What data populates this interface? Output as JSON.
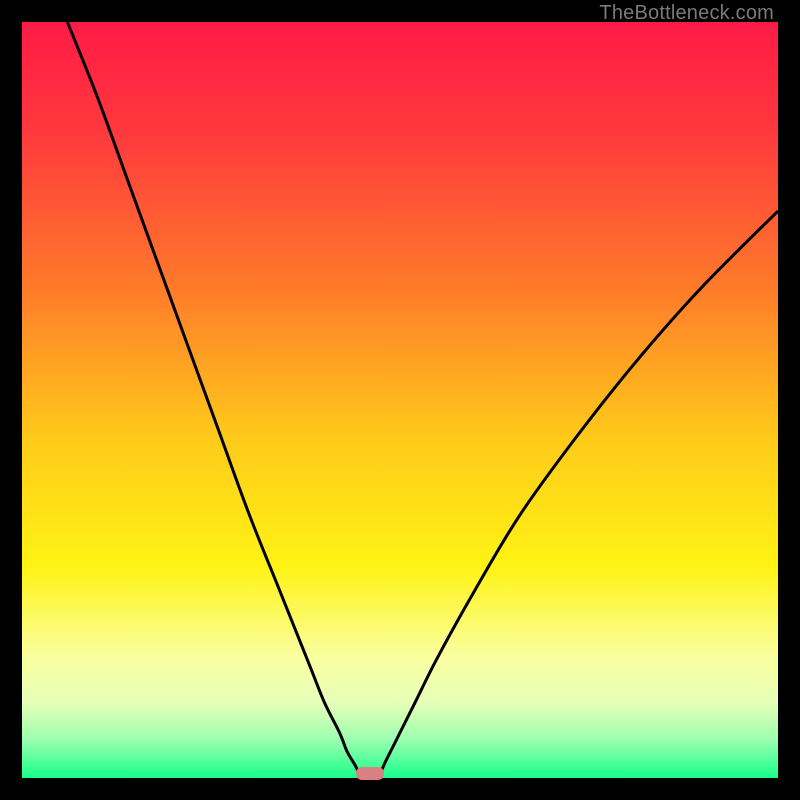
{
  "watermark": "TheBottleneck.com",
  "chart_data": {
    "type": "line",
    "title": "",
    "xlabel": "",
    "ylabel": "",
    "xlim": [
      0,
      100
    ],
    "ylim": [
      0,
      100
    ],
    "grid": false,
    "background_gradient": {
      "stops": [
        {
          "pos": 0.0,
          "color": "#ff1a46"
        },
        {
          "pos": 0.15,
          "color": "#ff3a3d"
        },
        {
          "pos": 0.35,
          "color": "#ff7a2a"
        },
        {
          "pos": 0.55,
          "color": "#ffca1a"
        },
        {
          "pos": 0.72,
          "color": "#fff314"
        },
        {
          "pos": 0.84,
          "color": "#faffa0"
        },
        {
          "pos": 0.9,
          "color": "#e6ffb8"
        },
        {
          "pos": 0.95,
          "color": "#9bffb0"
        },
        {
          "pos": 1.0,
          "color": "#18ff8a"
        }
      ]
    },
    "series": [
      {
        "name": "left-branch",
        "color": "#000000",
        "x": [
          6,
          10,
          14,
          18,
          22,
          26,
          30,
          34,
          38,
          40,
          42,
          43,
          44,
          44.5
        ],
        "y": [
          100,
          90,
          79,
          68,
          57,
          46,
          35,
          25,
          15,
          10,
          6,
          3.5,
          1.8,
          0.8
        ]
      },
      {
        "name": "right-branch",
        "color": "#000000",
        "x": [
          47.5,
          48,
          49,
          50,
          52,
          55,
          60,
          66,
          74,
          82,
          90,
          100
        ],
        "y": [
          0.8,
          2,
          4,
          6,
          10,
          16,
          25,
          35,
          46,
          56,
          65,
          75
        ]
      }
    ],
    "marker": {
      "name": "optimal-point",
      "shape": "pill",
      "color": "#d88082",
      "x": 46,
      "y": 0.6,
      "w": 3.7,
      "h": 1.6
    }
  }
}
